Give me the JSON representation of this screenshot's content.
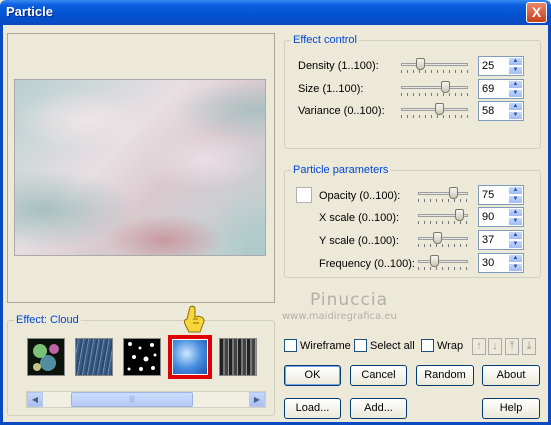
{
  "window": {
    "title": "Particle",
    "close_glyph": "X"
  },
  "effect_control": {
    "legend": "Effect control",
    "rows": [
      {
        "label": "Density (1..100):",
        "value": "25",
        "level": 0.25
      },
      {
        "label": "Size (1..100):",
        "value": "69",
        "level": 0.69
      },
      {
        "label": "Variance (0..100):",
        "value": "58",
        "level": 0.58
      }
    ]
  },
  "particle_parameters": {
    "legend": "Particle parameters",
    "rows": [
      {
        "label": "Opacity (0..100):",
        "value": "75",
        "level": 0.75
      },
      {
        "label": "X scale (0..100):",
        "value": "90",
        "level": 0.9
      },
      {
        "label": "Y scale (0..100):",
        "value": "37",
        "level": 0.37
      },
      {
        "label": "Frequency (0..100):",
        "value": "30",
        "level": 0.3
      }
    ]
  },
  "effect": {
    "legend": "Effect: Cloud",
    "selected_index": 3
  },
  "options": {
    "wireframe": "Wireframe",
    "select_all": "Select all",
    "wrap": "Wrap"
  },
  "buttons": {
    "ok": "OK",
    "cancel": "Cancel",
    "random": "Random",
    "about": "About",
    "load": "Load...",
    "add": "Add...",
    "help": "Help"
  },
  "arrows": {
    "up": "↑",
    "down": "↓",
    "top": "⤒",
    "bottom": "⤓"
  },
  "scrollbar": {
    "left": "◀",
    "right": "▶",
    "grip": "|||"
  },
  "watermark": {
    "name": "Pinuccia",
    "url": "www.maidiregrafica.eu"
  }
}
